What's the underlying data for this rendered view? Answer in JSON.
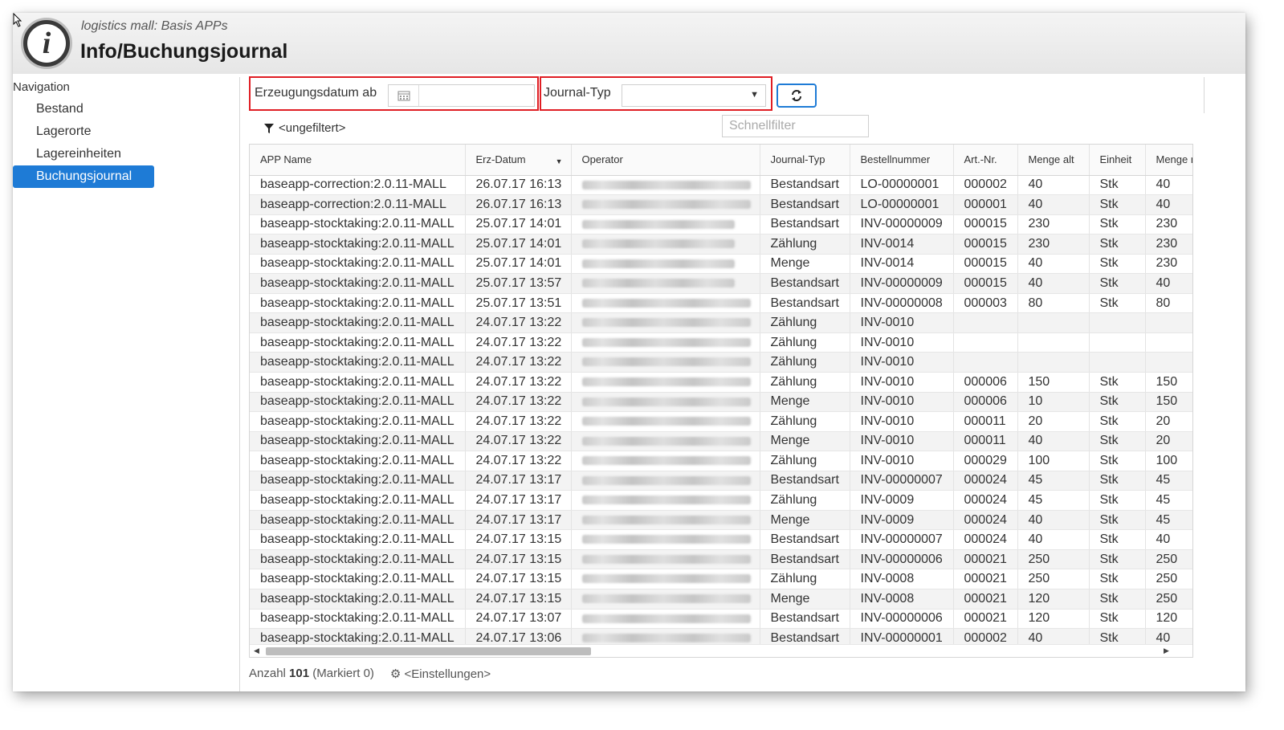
{
  "header": {
    "subtitle": "logistics mall: Basis APPs",
    "title": "Info/Buchungsjournal",
    "logo_glyph": "i"
  },
  "nav": {
    "heading": "Navigation",
    "items": [
      {
        "label": "Bestand",
        "active": false
      },
      {
        "label": "Lagerorte",
        "active": false
      },
      {
        "label": "Lagereinheiten",
        "active": false
      },
      {
        "label": "Buchungsjournal",
        "active": true
      }
    ]
  },
  "filters": {
    "date_label": "Erzeugungsdatum ab",
    "date_value": "",
    "journal_label": "Journal-Typ",
    "journal_value": "",
    "quick_filter_placeholder": "Schnellfilter",
    "filter_state": "<ungefiltert>",
    "refresh_icon": "refresh-icon",
    "calendar_icon": "calendar-icon",
    "filter_icon": "funnel-icon",
    "highlight_color": "#e01e24",
    "accent_color": "#1e7bd6"
  },
  "table": {
    "columns": [
      "APP Name",
      "Erz-Datum",
      "Operator",
      "Journal-Typ",
      "Bestellnummer",
      "Art.-Nr.",
      "Menge alt",
      "Einheit",
      "Menge n"
    ],
    "sorted_column": "Erz-Datum",
    "rows": [
      [
        "baseapp-correction:2.0.11-MALL",
        "26.07.17 16:13",
        "",
        "Bestandsart",
        "LO-00000001",
        "000002",
        "40",
        "Stk",
        "40"
      ],
      [
        "baseapp-correction:2.0.11-MALL",
        "26.07.17 16:13",
        "",
        "Bestandsart",
        "LO-00000001",
        "000001",
        "40",
        "Stk",
        "40"
      ],
      [
        "baseapp-stocktaking:2.0.11-MALL",
        "25.07.17 14:01",
        "",
        "Bestandsart",
        "INV-00000009",
        "000015",
        "230",
        "Stk",
        "230"
      ],
      [
        "baseapp-stocktaking:2.0.11-MALL",
        "25.07.17 14:01",
        "",
        "Zählung",
        "INV-0014",
        "000015",
        "230",
        "Stk",
        "230"
      ],
      [
        "baseapp-stocktaking:2.0.11-MALL",
        "25.07.17 14:01",
        "",
        "Menge",
        "INV-0014",
        "000015",
        "40",
        "Stk",
        "230"
      ],
      [
        "baseapp-stocktaking:2.0.11-MALL",
        "25.07.17 13:57",
        "",
        "Bestandsart",
        "INV-00000009",
        "000015",
        "40",
        "Stk",
        "40"
      ],
      [
        "baseapp-stocktaking:2.0.11-MALL",
        "25.07.17 13:51",
        "",
        "Bestandsart",
        "INV-00000008",
        "000003",
        "80",
        "Stk",
        "80"
      ],
      [
        "baseapp-stocktaking:2.0.11-MALL",
        "24.07.17 13:22",
        "",
        "Zählung",
        "INV-0010",
        "",
        "",
        "",
        ""
      ],
      [
        "baseapp-stocktaking:2.0.11-MALL",
        "24.07.17 13:22",
        "",
        "Zählung",
        "INV-0010",
        "",
        "",
        "",
        ""
      ],
      [
        "baseapp-stocktaking:2.0.11-MALL",
        "24.07.17 13:22",
        "",
        "Zählung",
        "INV-0010",
        "",
        "",
        "",
        ""
      ],
      [
        "baseapp-stocktaking:2.0.11-MALL",
        "24.07.17 13:22",
        "",
        "Zählung",
        "INV-0010",
        "000006",
        "150",
        "Stk",
        "150"
      ],
      [
        "baseapp-stocktaking:2.0.11-MALL",
        "24.07.17 13:22",
        "",
        "Menge",
        "INV-0010",
        "000006",
        "10",
        "Stk",
        "150"
      ],
      [
        "baseapp-stocktaking:2.0.11-MALL",
        "24.07.17 13:22",
        "",
        "Zählung",
        "INV-0010",
        "000011",
        "20",
        "Stk",
        "20"
      ],
      [
        "baseapp-stocktaking:2.0.11-MALL",
        "24.07.17 13:22",
        "",
        "Menge",
        "INV-0010",
        "000011",
        "40",
        "Stk",
        "20"
      ],
      [
        "baseapp-stocktaking:2.0.11-MALL",
        "24.07.17 13:22",
        "",
        "Zählung",
        "INV-0010",
        "000029",
        "100",
        "Stk",
        "100"
      ],
      [
        "baseapp-stocktaking:2.0.11-MALL",
        "24.07.17 13:17",
        "",
        "Bestandsart",
        "INV-00000007",
        "000024",
        "45",
        "Stk",
        "45"
      ],
      [
        "baseapp-stocktaking:2.0.11-MALL",
        "24.07.17 13:17",
        "",
        "Zählung",
        "INV-0009",
        "000024",
        "45",
        "Stk",
        "45"
      ],
      [
        "baseapp-stocktaking:2.0.11-MALL",
        "24.07.17 13:17",
        "",
        "Menge",
        "INV-0009",
        "000024",
        "40",
        "Stk",
        "45"
      ],
      [
        "baseapp-stocktaking:2.0.11-MALL",
        "24.07.17 13:15",
        "",
        "Bestandsart",
        "INV-00000007",
        "000024",
        "40",
        "Stk",
        "40"
      ],
      [
        "baseapp-stocktaking:2.0.11-MALL",
        "24.07.17 13:15",
        "",
        "Bestandsart",
        "INV-00000006",
        "000021",
        "250",
        "Stk",
        "250"
      ],
      [
        "baseapp-stocktaking:2.0.11-MALL",
        "24.07.17 13:15",
        "",
        "Zählung",
        "INV-0008",
        "000021",
        "250",
        "Stk",
        "250"
      ],
      [
        "baseapp-stocktaking:2.0.11-MALL",
        "24.07.17 13:15",
        "",
        "Menge",
        "INV-0008",
        "000021",
        "120",
        "Stk",
        "250"
      ],
      [
        "baseapp-stocktaking:2.0.11-MALL",
        "24.07.17 13:07",
        "",
        "Bestandsart",
        "INV-00000006",
        "000021",
        "120",
        "Stk",
        "120"
      ],
      [
        "baseapp-stocktaking:2.0.11-MALL",
        "24.07.17 13:06",
        "",
        "Bestandsart",
        "INV-00000001",
        "000002",
        "40",
        "Stk",
        "40"
      ]
    ]
  },
  "footer": {
    "count_label": "Anzahl",
    "count_value": "101",
    "marked_label": "(Markiert 0)",
    "settings_label": "<Einstellungen>",
    "settings_icon": "gear-icon"
  }
}
